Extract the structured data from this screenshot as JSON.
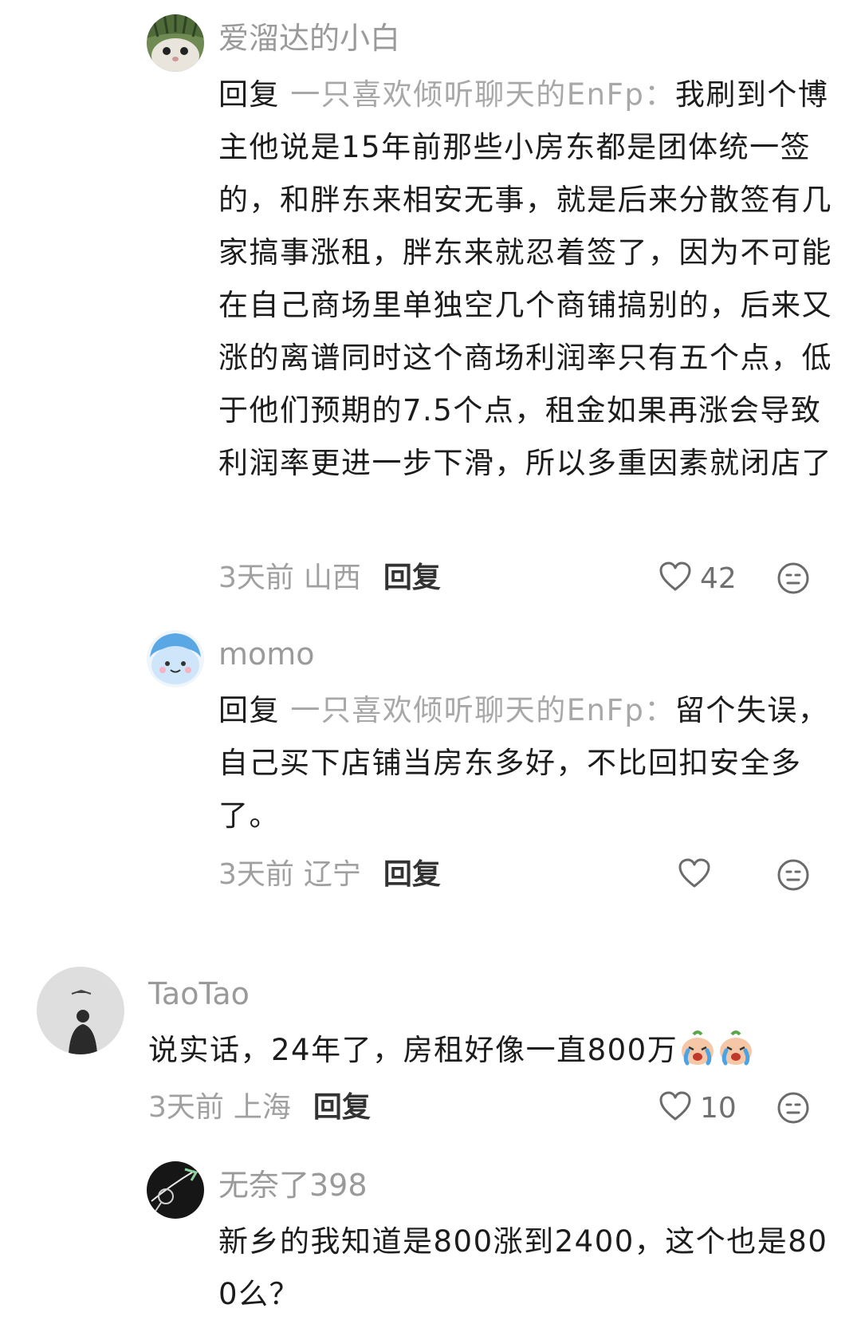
{
  "comments": [
    {
      "username": "爱溜达的小白",
      "reply_prefix": "回复",
      "reply_target": "一只喜欢倾听聊天的EnFp：",
      "text": "我刷到个博主他说是15年前那些小房东都是团体统一签的，和胖东来相安无事，就是后来分散签有几家搞事涨租，胖东来就忍着签了，因为不可能在自己商场里单独空几个商铺搞别的，后来又涨的离谱同时这个商场利润率只有五个点，低于他们预期的7.5个点，租金如果再涨会导致利润率更进一步下滑，所以多重因素就闭店了",
      "time": "3天前",
      "location": "山西",
      "reply_label": "回复",
      "likes": "42"
    },
    {
      "username": "momo",
      "reply_prefix": "回复",
      "reply_target": "一只喜欢倾听聊天的EnFp：",
      "text": "留个失误，自己买下店铺当房东多好，不比回扣安全多了。",
      "time": "3天前",
      "location": "辽宁",
      "reply_label": "回复",
      "likes": ""
    },
    {
      "username": "TaoTao",
      "text": "说实话，24年了，房租好像一直800万",
      "time": "3天前",
      "location": "上海",
      "reply_label": "回复",
      "likes": "10"
    },
    {
      "username": "无奈了398",
      "text": "新乡的我知道是800涨到2400，这个也是800么？"
    }
  ],
  "icons": {
    "like": "heart-outline-icon",
    "reaction": "neutral-face-icon",
    "inline_emoji": "crying-face-emoji"
  },
  "colors": {
    "username": "#9a9a9a",
    "body": "#1c1c1c",
    "meta": "#a0a0a0",
    "icon": "#6b6b6b"
  }
}
